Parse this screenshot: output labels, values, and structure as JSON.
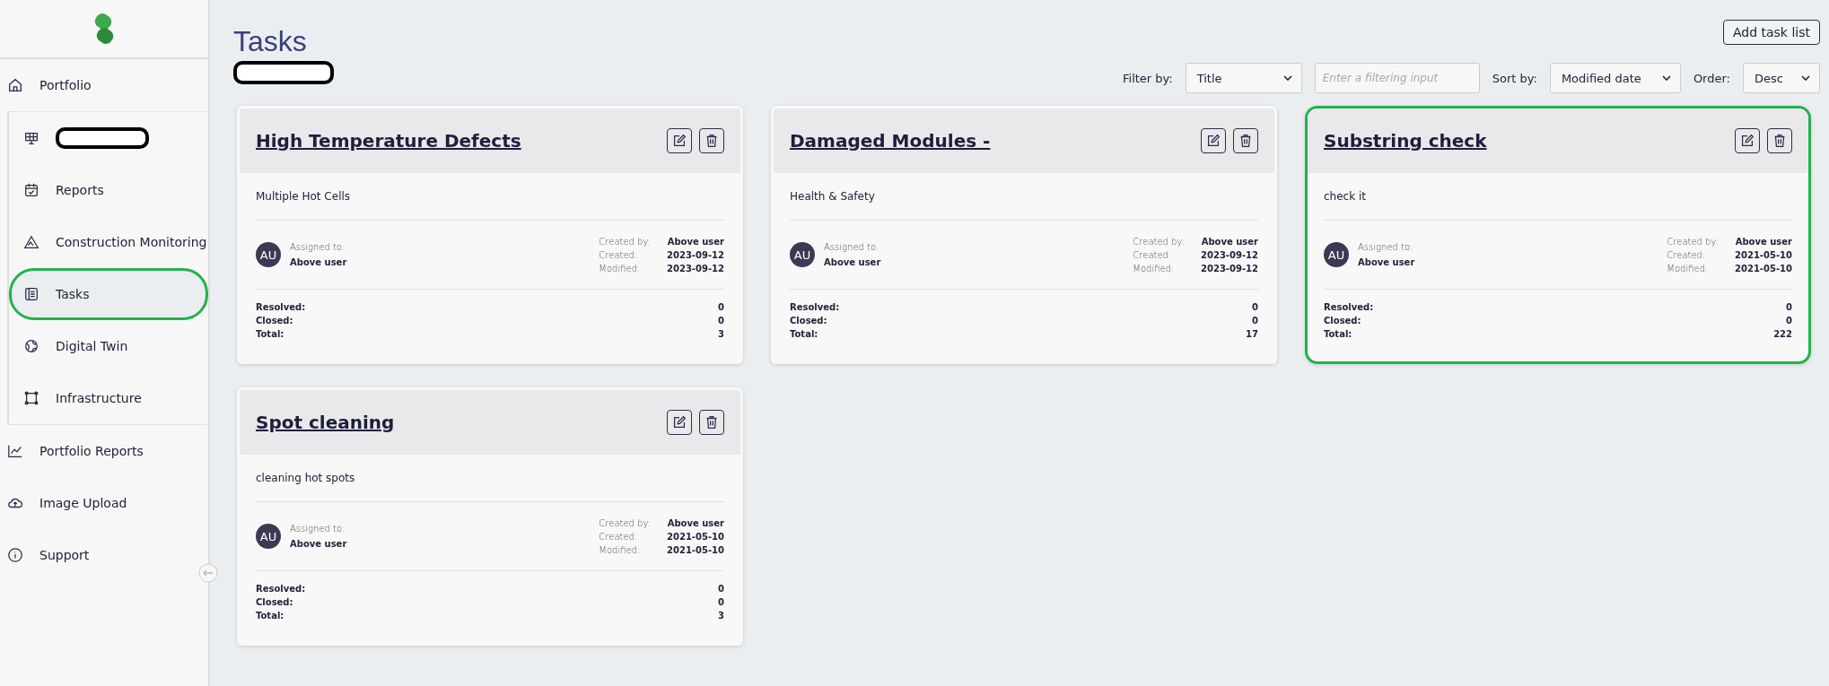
{
  "sidebar": {
    "top_items": [
      {
        "label": "Portfolio",
        "selected": false
      }
    ],
    "sub_items": [
      {
        "kind": "redacted",
        "selected": false,
        "highlighted": false
      },
      {
        "kind": "link",
        "label": "Reports",
        "selected": false,
        "highlighted": false
      },
      {
        "kind": "link",
        "label": "Construction Monitoring",
        "selected": false,
        "highlighted": false
      },
      {
        "kind": "link",
        "label": "Tasks",
        "selected": true,
        "highlighted": true
      },
      {
        "kind": "link",
        "label": "Digital Twin",
        "selected": false,
        "highlighted": false
      },
      {
        "kind": "link",
        "label": "Infrastructure",
        "selected": false,
        "highlighted": false
      }
    ],
    "bottom_items": [
      {
        "label": "Portfolio Reports",
        "selected": false
      },
      {
        "label": "Image Upload",
        "selected": false
      },
      {
        "label": "Support",
        "selected": false
      }
    ]
  },
  "page": {
    "title": "Tasks",
    "subtitle_redacted": true,
    "add_button": "Add task list"
  },
  "filters": {
    "filter_label": "Filter by:",
    "filter_value": "Title",
    "input_placeholder": "Enter a filtering input",
    "sort_label": "Sort by:",
    "sort_value": "Modified date",
    "order_label": "Order:",
    "order_value": "Desc"
  },
  "cards": [
    {
      "title": "High Temperature Defects",
      "description": "Multiple Hot Cells",
      "avatar": "AU",
      "assigned_label": "Assigned to:",
      "assignee": "Above user",
      "meta": [
        {
          "label": "Created by:",
          "value": "Above user"
        },
        {
          "label": "Created:",
          "value": "2023-09-12"
        },
        {
          "label": "Modified:",
          "value": "2023-09-12"
        }
      ],
      "stats": [
        {
          "label": "Resolved:",
          "value": "0"
        },
        {
          "label": "Closed:",
          "value": "0"
        },
        {
          "label": "Total:",
          "value": "3"
        }
      ],
      "highlighted": false
    },
    {
      "title": "Damaged Modules -",
      "description": "Health & Safety",
      "avatar": "AU",
      "assigned_label": "Assigned to:",
      "assignee": "Above user",
      "meta": [
        {
          "label": "Created by:",
          "value": "Above user"
        },
        {
          "label": "Created:",
          "value": "2023-09-12"
        },
        {
          "label": "Modified:",
          "value": "2023-09-12"
        }
      ],
      "stats": [
        {
          "label": "Resolved:",
          "value": "0"
        },
        {
          "label": "Closed:",
          "value": "0"
        },
        {
          "label": "Total:",
          "value": "17"
        }
      ],
      "highlighted": false
    },
    {
      "title": "Substring check",
      "description": "check it",
      "avatar": "AU",
      "assigned_label": "Assigned to:",
      "assignee": "Above user",
      "meta": [
        {
          "label": "Created by:",
          "value": "Above user"
        },
        {
          "label": "Created:",
          "value": "2021-05-10"
        },
        {
          "label": "Modified:",
          "value": "2021-05-10"
        }
      ],
      "stats": [
        {
          "label": "Resolved:",
          "value": "0"
        },
        {
          "label": "Closed:",
          "value": "0"
        },
        {
          "label": "Total:",
          "value": "222"
        }
      ],
      "highlighted": true
    },
    {
      "title": "Spot cleaning",
      "description": "cleaning hot spots",
      "avatar": "AU",
      "assigned_label": "Assigned to:",
      "assignee": "Above user",
      "meta": [
        {
          "label": "Created by:",
          "value": "Above user"
        },
        {
          "label": "Created:",
          "value": "2021-05-10"
        },
        {
          "label": "Modified:",
          "value": "2021-05-10"
        }
      ],
      "stats": [
        {
          "label": "Resolved:",
          "value": "0"
        },
        {
          "label": "Closed:",
          "value": "0"
        },
        {
          "label": "Total:",
          "value": "3"
        }
      ],
      "highlighted": false
    }
  ]
}
